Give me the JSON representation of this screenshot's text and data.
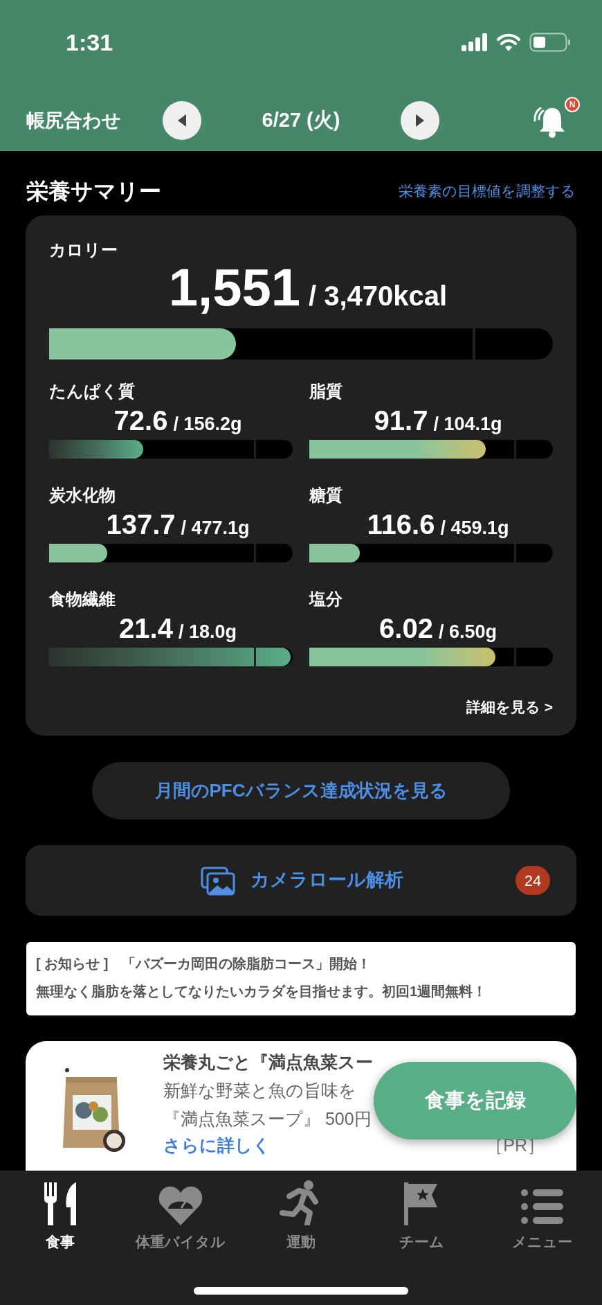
{
  "status_bar": {
    "time": "1:31"
  },
  "header": {
    "title": "帳尻合わせ",
    "date": "6/27 (火)",
    "notification_badge": "N"
  },
  "summary": {
    "title": "栄養サマリー",
    "adjust_link": "栄養素の目標値を調整する",
    "calorie": {
      "label": "カロリー",
      "value": "1,551",
      "target": "/ 3,470kcal",
      "level": 0.373
    },
    "nutrients": [
      {
        "label": "たんぱく質",
        "value": "72.6",
        "target": "/ 156.2g",
        "level": 0.39,
        "kind": "fade"
      },
      {
        "label": "脂質",
        "value": "91.7",
        "target": "/ 104.1g",
        "level": 0.73,
        "kind": "warn"
      },
      {
        "label": "炭水化物",
        "value": "137.7",
        "target": "/ 477.1g",
        "level": 0.24,
        "kind": "plain"
      },
      {
        "label": "糖質",
        "value": "116.6",
        "target": "/ 459.1g",
        "level": 0.21,
        "kind": "plain"
      },
      {
        "label": "食物繊維",
        "value": "21.4",
        "target": "/ 18.0g",
        "level": 1,
        "kind": "fade"
      },
      {
        "label": "塩分",
        "value": "6.02",
        "target": "/ 6.50g",
        "level": 0.77,
        "kind": "warn"
      }
    ],
    "details_link": "詳細を見る >"
  },
  "pfc_button": "月間のPFCバランス達成状況を見る",
  "camera_roll": {
    "label": "カメラロール解析",
    "badge": "24"
  },
  "notice": {
    "lines": [
      "[ お知らせ ]　「バズーカ岡田の除脂肪コース」開始！",
      "無理なく脂肪を落としてなりたいカラダを目指せます。初回1週間無料！"
    ]
  },
  "ad": {
    "title": "栄養丸ごと『満点魚菜スー",
    "lines": [
      "新鮮な野菜と魚の旨味を",
      "『満点魚菜スープ』 500円"
    ],
    "link": "さらに詳しく",
    "tag": "［PR］"
  },
  "fab": "食事を記録",
  "tab_bar": [
    {
      "label": "食事",
      "selected": true
    },
    {
      "label": "体重バイタル",
      "selected": false
    },
    {
      "label": "運動",
      "selected": false
    },
    {
      "label": "チーム",
      "selected": false
    },
    {
      "label": "メニュー",
      "selected": false
    }
  ]
}
